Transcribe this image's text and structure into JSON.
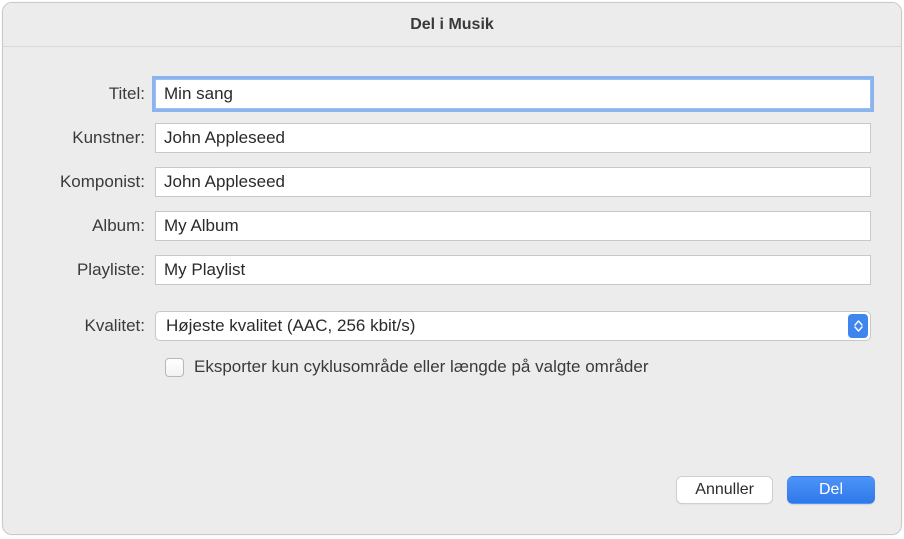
{
  "window": {
    "title": "Del i Musik"
  },
  "labels": {
    "title": "Titel:",
    "artist": "Kunstner:",
    "composer": "Komponist:",
    "album": "Album:",
    "playlist": "Playliste:",
    "quality": "Kvalitet:"
  },
  "fields": {
    "title": "Min sang",
    "artist": "John Appleseed",
    "composer": "John Appleseed",
    "album": "My Album",
    "playlist": "My Playlist"
  },
  "quality": {
    "selected": "Højeste kvalitet (AAC, 256 kbit/s)"
  },
  "checkbox": {
    "export_cycle_label": "Eksporter kun cyklusområde eller længde på valgte områder",
    "export_cycle_checked": false
  },
  "buttons": {
    "cancel": "Annuller",
    "share": "Del"
  }
}
